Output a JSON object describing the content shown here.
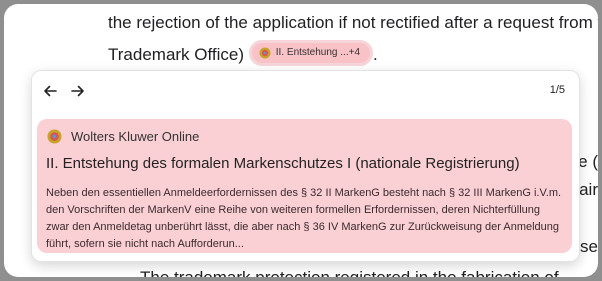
{
  "document": {
    "line1": "the rejection of the application if not rectified after a request from th",
    "line2": "Trademark Office)",
    "line2_end": ".",
    "line3": "The trademark protection registered in the fabrication of",
    "right_fragments": [
      "e (",
      "air",
      "se"
    ]
  },
  "citation_chip": {
    "label": "II. Entstehung ...+4",
    "icon": "wolters-kluwer-logo-icon"
  },
  "popup": {
    "pager": "1/5",
    "back_icon": "arrow-left-icon",
    "forward_icon": "arrow-right-icon",
    "source_icon": "wolters-kluwer-logo-icon",
    "source_name": "Wolters Kluwer Online",
    "title": "II. Entstehung des formalen Markenschutzes I (nationale Registrierung)",
    "body": "Neben den essentiellen Anmeldeerfordernissen des § 32 II MarkenG besteht nach § 32 III MarkenG i.V.m. den Vorschriften der MarkenV eine Reihe von weiteren formellen Erfordernissen, deren Nichterfüllung zwar den Anmeldetag unberührt lässt, die aber nach § 36 IV MarkenG zur Zurückweisung der Anmeldung führt, sofern sie nicht nach Aufforderun..."
  },
  "colors": {
    "card_background": "#fbd0d5",
    "chip_background": "#f8c2c7"
  }
}
